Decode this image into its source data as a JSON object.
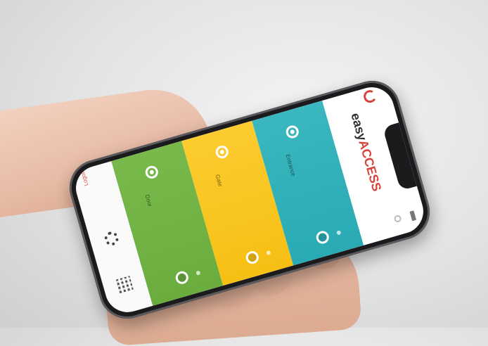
{
  "nav": {
    "top_label": "Logout",
    "items": [
      {
        "name": "settings",
        "icon": "gear-icon"
      },
      {
        "name": "qr-code",
        "icon": "qr-code-icon"
      }
    ]
  },
  "panels": [
    {
      "name": "green",
      "color": "#6aad3e",
      "label": "Door",
      "icon": "lock-icon"
    },
    {
      "name": "yellow",
      "color": "#f6bf14",
      "label": "Gate",
      "icon": "lock-icon"
    },
    {
      "name": "teal",
      "color": "#2aaab3",
      "label": "Entrance",
      "icon": "lock-icon"
    }
  ],
  "brand": {
    "name_part1": "easy",
    "name_part2": "ACCESS",
    "subtitle": "",
    "accent_color": "#d9423a"
  }
}
